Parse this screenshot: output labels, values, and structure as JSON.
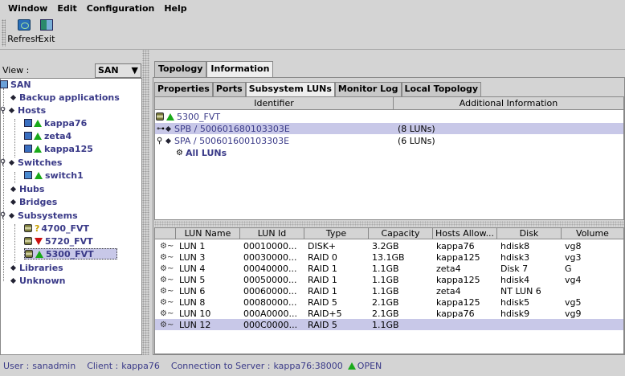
{
  "menu": {
    "items": [
      {
        "label": "Window"
      },
      {
        "label": "Edit"
      },
      {
        "label": "Configuration"
      },
      {
        "label": "Help"
      }
    ]
  },
  "toolbar": {
    "refresh_label": "Refresh",
    "exit_label": "Exit"
  },
  "left": {
    "view_label": "View :",
    "view_value": "SAN",
    "tree": {
      "san": "SAN",
      "backup": "Backup applications",
      "hosts": "Hosts",
      "kappa76": "kappa76",
      "zeta4": "zeta4",
      "kappa125": "kappa125",
      "switches": "Switches",
      "switch1": "switch1",
      "hubs": "Hubs",
      "bridges": "Bridges",
      "subsystems": "Subsystems",
      "s4700": "4700_FVT",
      "s5720": "5720_FVT",
      "s5300": "5300_FVT",
      "libraries": "Libraries",
      "unknown": "Unknown"
    }
  },
  "tabs_outer": [
    "Topology",
    "Information"
  ],
  "tabs_inner": [
    "Properties",
    "Ports",
    "Subsystem LUNs",
    "Monitor Log",
    "Local Topology"
  ],
  "top_table": {
    "headers": [
      "Identifier",
      "Additional Information"
    ],
    "root": "5300_FVT",
    "spb": "SPB / 500601680103303E",
    "spb_info": "(8 LUNs)",
    "spa": "SPA / 500601600103303E",
    "spa_info": "(6 LUNs)",
    "all_luns": "All LUNs"
  },
  "lun_table": {
    "headers": [
      "LUN Name",
      "LUN Id",
      "Type",
      "Capacity",
      "Hosts Allow...",
      "Disk",
      "Volume"
    ],
    "rows": [
      [
        "LUN 1",
        "00010000...",
        "DISK+",
        "3.2GB",
        "kappa76",
        "hdisk8",
        "vg8"
      ],
      [
        "LUN 3",
        "00030000...",
        "RAID 0",
        "13.1GB",
        "kappa125",
        "hdisk3",
        "vg3"
      ],
      [
        "LUN 4",
        "00040000...",
        "RAID 1",
        "1.1GB",
        "zeta4",
        "Disk 7",
        "G"
      ],
      [
        "LUN 5",
        "00050000...",
        "RAID 1",
        "1.1GB",
        "kappa125",
        "hdisk4",
        "vg4"
      ],
      [
        "LUN 6",
        "00060000...",
        "RAID 1",
        "1.1GB",
        "zeta4",
        "NT LUN 6",
        ""
      ],
      [
        "LUN 8",
        "00080000...",
        "RAID 5",
        "2.1GB",
        "kappa125",
        "hdisk5",
        "vg5"
      ],
      [
        "LUN 10",
        "000A0000...",
        "RAID+5",
        "2.1GB",
        "kappa76",
        "hdisk9",
        "vg9"
      ],
      [
        "LUN 12",
        "000C0000...",
        "RAID 5",
        "1.1GB",
        "",
        "",
        ""
      ]
    ]
  },
  "status": {
    "user_label": "User :",
    "user": "sanadmin",
    "client_label": "Client :",
    "client": "kappa76",
    "conn_label": "Connection to Server :",
    "server": "kappa76:38000",
    "state": "OPEN"
  }
}
